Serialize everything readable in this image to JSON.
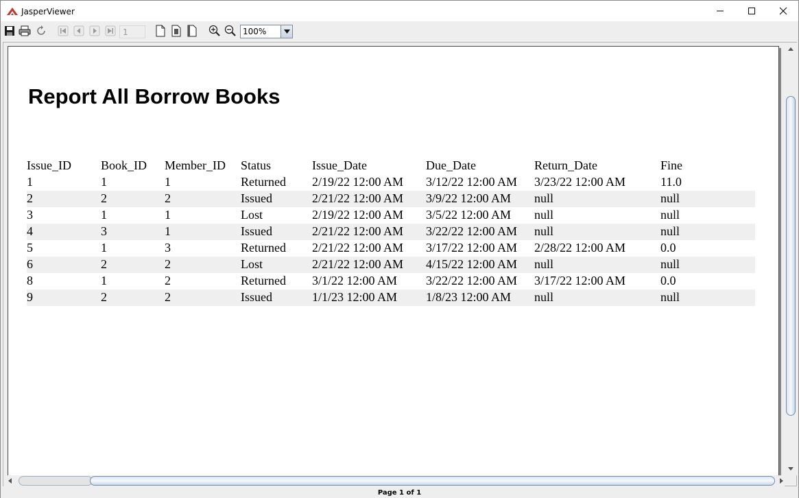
{
  "window": {
    "title": "JasperViewer"
  },
  "toolbar": {
    "buttons": [
      {
        "name": "save-icon",
        "enabled": true
      },
      {
        "name": "print-icon",
        "enabled": true
      },
      {
        "name": "reload-icon",
        "enabled": true
      },
      {
        "name": "first-page-icon",
        "enabled": false
      },
      {
        "name": "previous-page-icon",
        "enabled": false
      },
      {
        "name": "next-page-icon",
        "enabled": false
      },
      {
        "name": "last-page-icon",
        "enabled": false
      },
      {
        "name": "actual-size-icon",
        "enabled": true
      },
      {
        "name": "fit-page-icon",
        "enabled": true
      },
      {
        "name": "fit-width-icon",
        "enabled": true
      },
      {
        "name": "zoom-in-icon",
        "enabled": true
      },
      {
        "name": "zoom-out-icon",
        "enabled": true
      }
    ],
    "page_number": "1",
    "zoom": "100%"
  },
  "report": {
    "title": "Report All Borrow Books",
    "columns": [
      "Issue_ID",
      "Book_ID",
      "Member_ID",
      "Status",
      "Issue_Date",
      "Due_Date",
      "Return_Date",
      "Fine"
    ],
    "rows": [
      [
        "1",
        "1",
        "1",
        "Returned",
        "2/19/22 12:00 AM",
        "3/12/22 12:00 AM",
        "3/23/22 12:00 AM",
        "11.0"
      ],
      [
        "2",
        "2",
        "2",
        "Issued",
        "2/21/22 12:00 AM",
        "3/9/22 12:00 AM",
        "null",
        "null"
      ],
      [
        "3",
        "1",
        "1",
        "Lost",
        "2/19/22 12:00 AM",
        "3/5/22 12:00 AM",
        "null",
        "null"
      ],
      [
        "4",
        "3",
        "1",
        "Issued",
        "2/21/22 12:00 AM",
        "3/22/22 12:00 AM",
        "null",
        "null"
      ],
      [
        "5",
        "1",
        "3",
        "Returned",
        "2/21/22 12:00 AM",
        "3/17/22 12:00 AM",
        "2/28/22 12:00 AM",
        "0.0"
      ],
      [
        "6",
        "2",
        "2",
        "Lost",
        "2/21/22 12:00 AM",
        "4/15/22 12:00 AM",
        "null",
        "null"
      ],
      [
        "8",
        "1",
        "2",
        "Returned",
        "3/1/22 12:00 AM",
        "3/22/22 12:00 AM",
        "3/17/22 12:00 AM",
        "0.0"
      ],
      [
        "9",
        "2",
        "2",
        "Issued",
        "1/1/23 12:00 AM",
        "1/8/23 12:00 AM",
        "null",
        "null"
      ]
    ]
  },
  "status": {
    "page_label": "Page 1 of 1"
  },
  "colors": {
    "row_alt": "#efefef",
    "scroll_thumb": "#dbe6f1",
    "logo_red": "#c0392b"
  }
}
